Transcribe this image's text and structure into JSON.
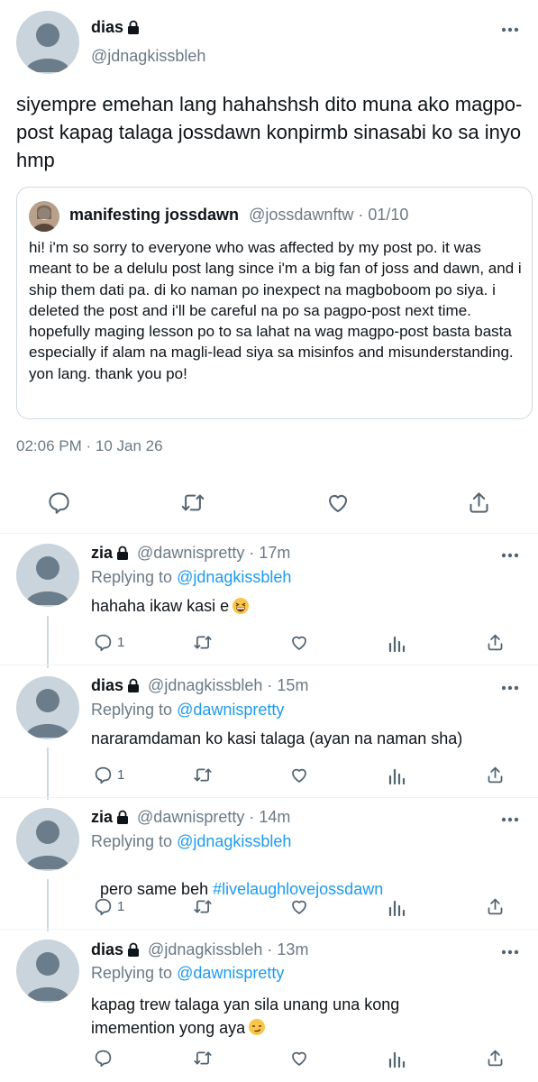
{
  "main_tweet": {
    "name": "dias",
    "handle": "@jdnagkissbleh",
    "text": "siyempre emehan lang hahahshsh dito muna ako magpo-post kapag talaga jossdawn konpirmb sinasabi ko sa inyo hmp",
    "quote": {
      "name": "manifesting jossdawn",
      "handle": "@jossdawnftw",
      "date": "· 01/10",
      "text": "hi! i'm so sorry to everyone who was affected by my post po. it was meant to be a delulu post lang since i'm a big fan of joss and dawn, and i ship them dati pa. di ko naman po inexpect na magboboom po siya. i deleted the post and i'll be careful na po sa pagpo-post next time. hopefully maging lesson po to sa lahat na wag magpo-post basta basta especially if alam na magli-lead siya sa misinfos and misunderstanding. yon lang. thank you po!"
    },
    "timestamp": "02:06 PM · 10 Jan 26"
  },
  "replies": [
    {
      "name": "zia",
      "handle": "@dawnispretty",
      "time": "· 17m",
      "replying_label": "Replying to",
      "replying_to": "@jdnagkissbleh",
      "text": "hahaha ikaw kasi e",
      "reply_count": "1"
    },
    {
      "name": "dias",
      "handle": "@jdnagkissbleh",
      "time": "· 15m",
      "replying_label": "Replying to",
      "replying_to": "@dawnispretty",
      "text": "nararamdaman ko kasi talaga (ayan na naman sha)",
      "reply_count": "1"
    },
    {
      "name": "zia",
      "handle": "@dawnispretty",
      "time": "· 14m",
      "replying_label": "Replying to",
      "replying_to": "@jdnagkissbleh",
      "text_prefix": "pero same beh ",
      "hashtag": "#livelaughlovejossdawn",
      "reply_count": "1"
    },
    {
      "name": "dias",
      "handle": "@jdnagkissbleh",
      "time": "· 13m",
      "replying_label": "Replying to",
      "replying_to": "@dawnispretty",
      "text": "kapag trew talaga yan sila unang una kong imemention yong aya",
      "reply_count": ""
    }
  ],
  "colors": {
    "link": "#1d9bf0",
    "muted": "#6b7a86",
    "icon": "#536471",
    "avatar_bg": "#c9d4dc",
    "avatar_fg": "#6b7c8a"
  },
  "icons": [
    "lock-icon",
    "more-icon",
    "reply-icon",
    "retweet-icon",
    "like-icon",
    "share-icon",
    "analytics-icon"
  ]
}
